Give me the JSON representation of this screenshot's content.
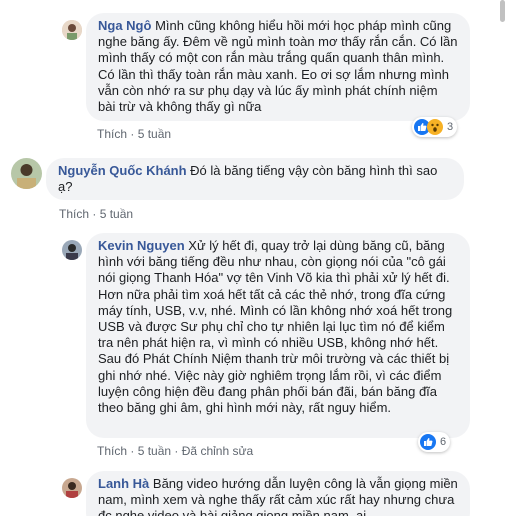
{
  "comments": [
    {
      "author": "Nga Ngô",
      "text": "Mình cũng không hiểu hồi mới học pháp mình cũng nghe băng ấy. Đêm về ngủ mình toàn mơ thấy rắn cắn. Có lần mình thấy có một con rắn màu trắng quấn quanh thân mình. Có lần thì thấy toàn rắn màu xanh. Eo ơi sợ lắm nhưng mình vẫn còn nhớ ra sư phụ dạy và lúc ấy mình phát chính niệm bài trừ và không thấy gì nữa",
      "like": "Thích",
      "time": "5 tuần",
      "reaction_count": "3",
      "reactions": [
        "like-icon",
        "wow-icon"
      ]
    },
    {
      "author": "Nguyễn Quốc Khánh",
      "text": "Đó là băng tiếng vậy còn băng hình thì sao ạ?",
      "like": "Thích",
      "time": "5 tuần"
    },
    {
      "author": "Kevin Nguyen",
      "text": "Xử lý hết đi, quay trở lại dùng băng cũ, băng hình với băng tiếng đều như nhau, còn giọng nói của \"cô gái nói giọng Thanh Hóa\" vợ tên Vinh Võ kia thì phải xử lý hết đi. Hơn nữa phải tìm xoá hết tất cả các thẻ nhớ, trong đĩa cứng máy tính, USB, v.v, nhé. Mình có lần không nhớ xoá hết trong USB và được Sư phụ chỉ cho tự nhiên lại lục tìm nó để kiểm tra nên phát hiện ra, vì mình có nhiều USB, không nhớ hết. Sau đó Phát Chính Niệm thanh trừ môi trường và các thiết bị ghi nhớ nhé. Việc này giờ nghiêm trọng lắm rồi, vì các điểm luyện công hiện đều đang phân phối bán đãi, bán băng đĩa theo băng ghi âm, ghi hình mới này, rất nguy hiểm.",
      "like": "Thích",
      "time": "5 tuần",
      "edited": "Đã chỉnh sửa",
      "reaction_count": "6",
      "reactions": [
        "like-icon"
      ]
    },
    {
      "author": "Lanh Hà",
      "text": "Băng video hướng dẫn luyện công là vẫn giọng miền nam, mình xem và nghe thấy rất cảm xúc rất hay nhưng chưa đc nghe video và bài giảng giọng miền nam, ai"
    }
  ],
  "separator": "·",
  "colors": {
    "name": "#385898",
    "bubble": "#f2f3f5",
    "like": "#1877f2",
    "wow": "#f7b125"
  }
}
